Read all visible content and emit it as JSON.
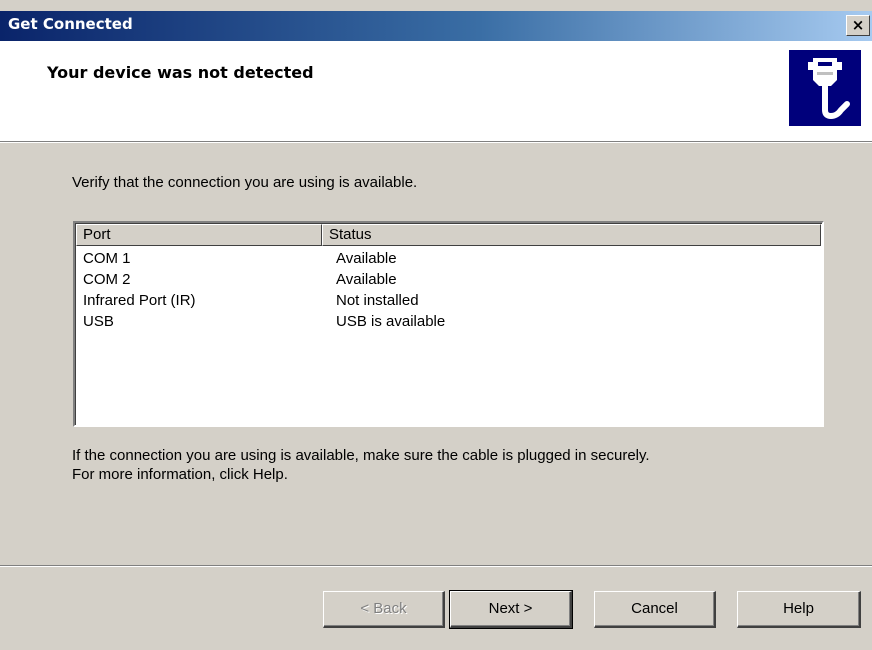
{
  "window": {
    "title": "Get Connected",
    "close_label": "×"
  },
  "header": {
    "title": "Your device was not detected",
    "icon": "cable-connector-icon"
  },
  "intro_text": "Verify that the connection you are using is available.",
  "port_list": {
    "columns": [
      "Port",
      "Status"
    ],
    "rows": [
      {
        "port": "COM 1",
        "status": "Available"
      },
      {
        "port": "COM 2",
        "status": "Available"
      },
      {
        "port": "Infrared Port (IR)",
        "status": "Not installed"
      },
      {
        "port": "USB",
        "status": "USB is available"
      }
    ]
  },
  "help_text": {
    "line1": "If the connection you are using is available, make sure the cable is plugged in securely.",
    "line2": "For more information, click Help."
  },
  "buttons": {
    "back": "< Back",
    "next": "Next >",
    "cancel": "Cancel",
    "help": "Help"
  },
  "colors": {
    "titlebar_start": "#0a246a",
    "titlebar_end": "#a6caf0",
    "dialog_face": "#d4d0c8",
    "icon_background": "#00007b"
  }
}
